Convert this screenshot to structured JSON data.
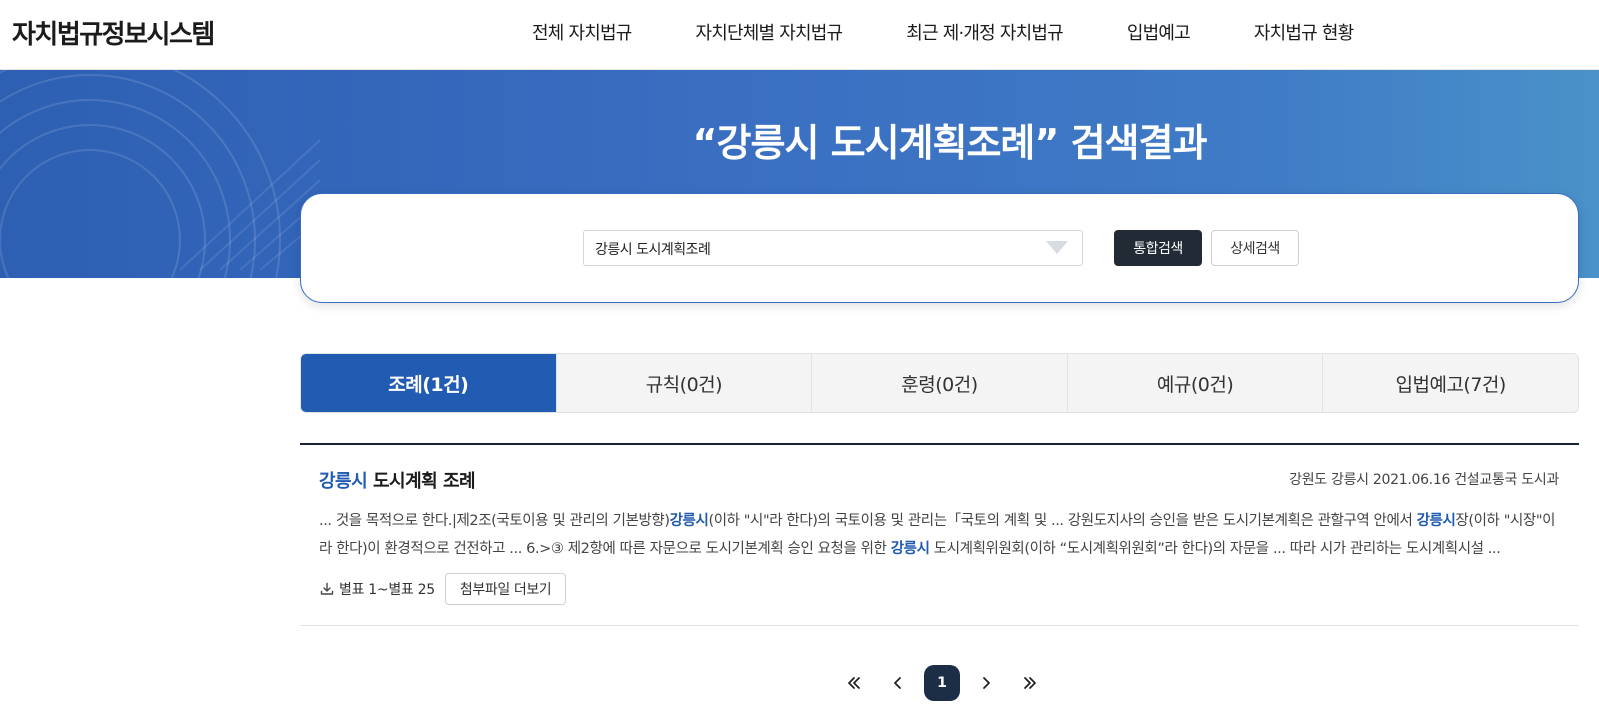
{
  "header": {
    "logo": "자치법규정보시스템",
    "nav": [
      "전체 자치법규",
      "자치단체별 자치법규",
      "최근 제·개정 자치법규",
      "입법예고",
      "자치법규 현황"
    ]
  },
  "banner": {
    "title": "“강릉시 도시계획조례” 검색결과"
  },
  "search": {
    "value": "강릉시 도시계획조례",
    "integrated_button": "통합검색",
    "detail_button": "상세검색"
  },
  "tabs": [
    {
      "label": "조례(1건)",
      "active": true
    },
    {
      "label": "규칙(0건)",
      "active": false
    },
    {
      "label": "훈령(0건)",
      "active": false
    },
    {
      "label": "예규(0건)",
      "active": false
    },
    {
      "label": "입법예고(7건)",
      "active": false
    }
  ],
  "results": [
    {
      "title_highlight": "강릉시",
      "title_rest": " 도시계획 조례",
      "meta": "강원도 강릉시 2021.06.16 건설교통국 도시과",
      "desc_1": "... 것을 목적으로 한다.|제2조(국토이용 및 관리의 기본방향)",
      "desc_hl_1": "강릉시",
      "desc_2": "(이하 \"시\"라 한다)의 국토이용 및 관리는「국토의 계획 및 ... 강원도지사의 승인을 받은 도시기본계획은 관할구역 안에서 ",
      "desc_hl_2": "강릉시",
      "desc_3": "장(이하 \"시장\"이라 한다)이 환경적으로 건전하고 ... 6.>③ 제2항에 따른 자문으로 도시기본계획 승인 요청을 위한 ",
      "desc_hl_3": "강릉시",
      "desc_4": " 도시계획위원회(이하 “도시계획위원회”라 한다)의 자문을 ... 따라 시가 관리하는 도시계획시설 ...",
      "attachment_label": "별표 1~별표 25",
      "more_button": "첨부파일 더보기"
    }
  ],
  "pagination": {
    "current": "1"
  }
}
